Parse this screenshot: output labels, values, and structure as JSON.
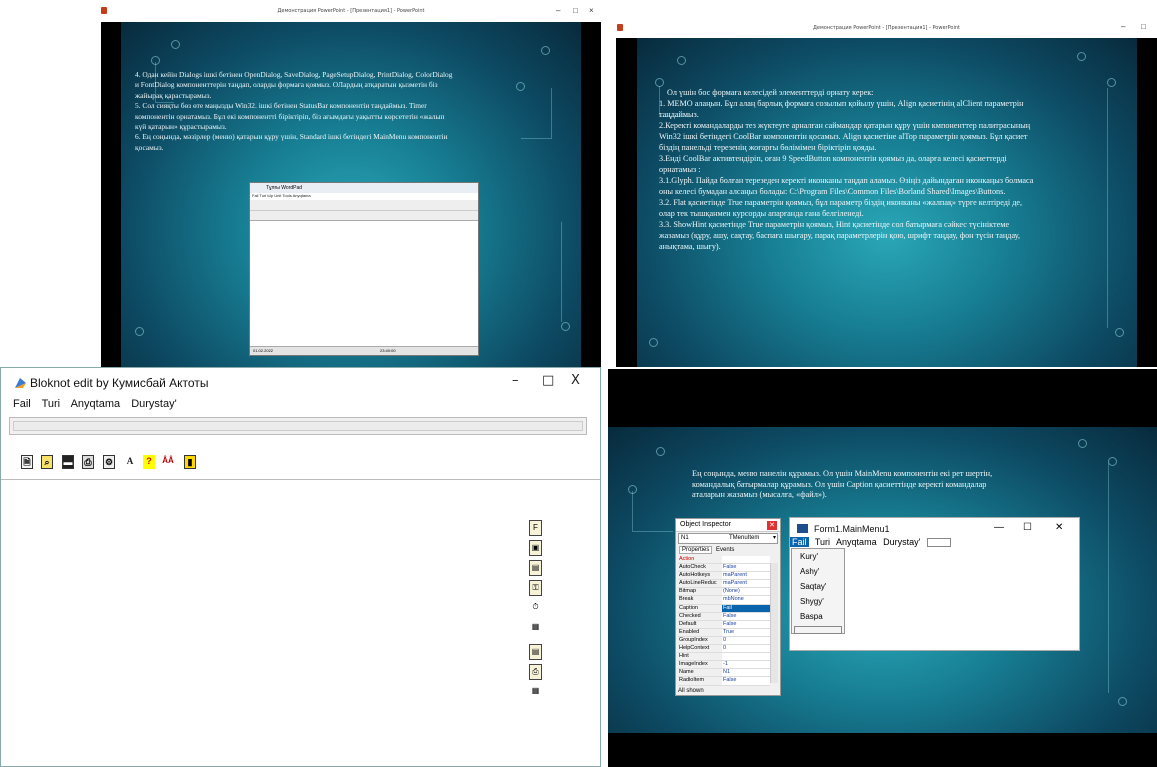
{
  "ppt1": {
    "title": "Демонстрация PowerPoint - [Презентация1] - PowerPoint",
    "controls": [
      "–",
      "□",
      "×"
    ],
    "lines": [
      "4. Одан кейін Dialogs ішкі бетінен OpenDialog, SaveDialog, PageSetupDialog, PrintDialog, ColorDialog",
      "и FontDialog компоненттерін таңдап, оларды формаға қоямыз. OЛардың атқаратын қызметін біз",
      "жайырақ қарастырамыз.",
      "5. Сол сияқты бөз өте маңызды Win32. ішкі бетінен StatusBar компонентін таңдаймыз. Timer",
      "компонентін орнатамыз. Бұл екі компонентті біріктіріп, біз ағымдағы уақытты көрсететін «жалып",
      "күй қатарын» құрастырамыз.",
      "6. Ең соңында, мәзірлер (меню) қатарын құру үшін, Standard ішкі бетіндегі MainMenu компонентін",
      "қосамыз."
    ],
    "mini_title": "Тұлғы WordPad",
    "mini_menu": "Fail  Turi  Ыр  Unit  Tools  Anyqtama",
    "mini_status_left": "01.02.2022",
    "mini_status_right": "23:40:00"
  },
  "ppt2": {
    "title": "Демонстрация PowerPoint - [Презентация1] - PowerPoint",
    "controls": [
      "–",
      "□"
    ],
    "lines": [
      "Ол үшін бос формаға келесідей элементтерді орнату керек:",
      "1. MEMO алаңын. Бұл алаң барлық формаға созылып қойылу үшін, Align қасиетінің alClient параметрін",
      "таңдаймыз.",
      "2.Керекті командаларды тез жүктеуге арналған саймандар қатарын құру үшін кмпоненттер палитрасының",
      "Win32 ішкі бетіндегі CoolBar компонентін қосамыз. Align қасиетіне  alTop параметрін қоямыз. Бұл қасиет",
      "біздің  панельді терезенің жоғарғы бөлімімен біріктіріп қояды.",
      "3.Енді CoolBar активтендіріп, оған 9 SpeedButton компонентін қоямыз да, оларға келесі қасиеттерді",
      "орнатамыз :",
      "3.1.Glyph. Пайда болған терезеден керекті иконканы таңдап аламыз. Өзіңіз дайындаған иконкаңыз болмаса",
      "оны келесі бумадан алсаңыз болады: C:\\Program Files\\Common Files\\Borland Shared\\Images\\Buttons.",
      "3.2. Flat қасиетінде True параметрін қоямыз, бұл параметр біздің иконканы «жалпақ» түрге келтіреді де,",
      "олар тек тышқанмен курсорды апарғанда ғана белгіленеді.",
      "3.3. ShowHint қасиетінде True параметрін қоямыз, Hint қасиетінде сол батырмаға сәйкес түсініктеме",
      "жазамыз (құру, ашу, сақтау, баспаға шығару, парақ параметрлерін қою, шрифт таңдау, фон түсін таңдау,",
      "анықтама, шығу)."
    ]
  },
  "bloknot": {
    "title": "Bloknot edit by Кумисбай Актоты",
    "controls": [
      "–",
      "□",
      "X"
    ],
    "menu": [
      "Fail",
      "Turi",
      "Anyqtama",
      "Durystay'"
    ],
    "tools": [
      "new",
      "open",
      "save",
      "print",
      "page-setup",
      "font",
      "help",
      "font-color",
      "exit"
    ],
    "tool_glyphs": [
      "🗎",
      "⌕",
      "▬",
      "⎙",
      "⚙",
      "A",
      "?",
      "ÂÂ",
      "▮"
    ],
    "component_glyphs": [
      "F",
      "▣",
      "▤",
      "⚿",
      "⏱",
      "▦",
      "▤",
      "⎙",
      "▦"
    ]
  },
  "ppt4": {
    "text_lines": [
      "Ең соңында,  меню панелін құрамыз. Ол үшін MainMenu компонентін екі рет шертін,",
      "командалық батырмалар құрамыз. Ол үшін Caption қасиеттінде керекті командалар",
      "аталарын жазамыз  (мысалға,  «файл»)."
    ],
    "inspector": {
      "title": "Object Inspector",
      "object": "N1",
      "type": "TMenuItem",
      "tabs": [
        "Properties",
        "Events"
      ],
      "rows": [
        [
          "Action",
          ""
        ],
        [
          "AutoCheck",
          "False"
        ],
        [
          "AutoHotkeys",
          "maParent"
        ],
        [
          "AutoLineReduc",
          "maParent"
        ],
        [
          "Bitmap",
          "(None)"
        ],
        [
          "Break",
          "mbNone"
        ],
        [
          "Caption",
          "Fail"
        ],
        [
          "Checked",
          "False"
        ],
        [
          "Default",
          "False"
        ],
        [
          "Enabled",
          "True"
        ],
        [
          "GroupIndex",
          "0"
        ],
        [
          "HelpContext",
          "0"
        ],
        [
          "Hint",
          ""
        ],
        [
          "ImageIndex",
          "-1"
        ],
        [
          "Name",
          "N1"
        ],
        [
          "RadioItem",
          "False"
        ]
      ],
      "footer": "All shown"
    },
    "form": {
      "title": "Form1.MainMenu1",
      "controls": [
        "—",
        "☐",
        "✕"
      ],
      "menu": [
        "Fail",
        "Turi",
        "Anyqtama",
        "Durystay'"
      ],
      "dropdown": [
        "Kury'",
        "Ashy'",
        "Saqtay'",
        "Shygy'",
        "Baspa"
      ]
    }
  }
}
